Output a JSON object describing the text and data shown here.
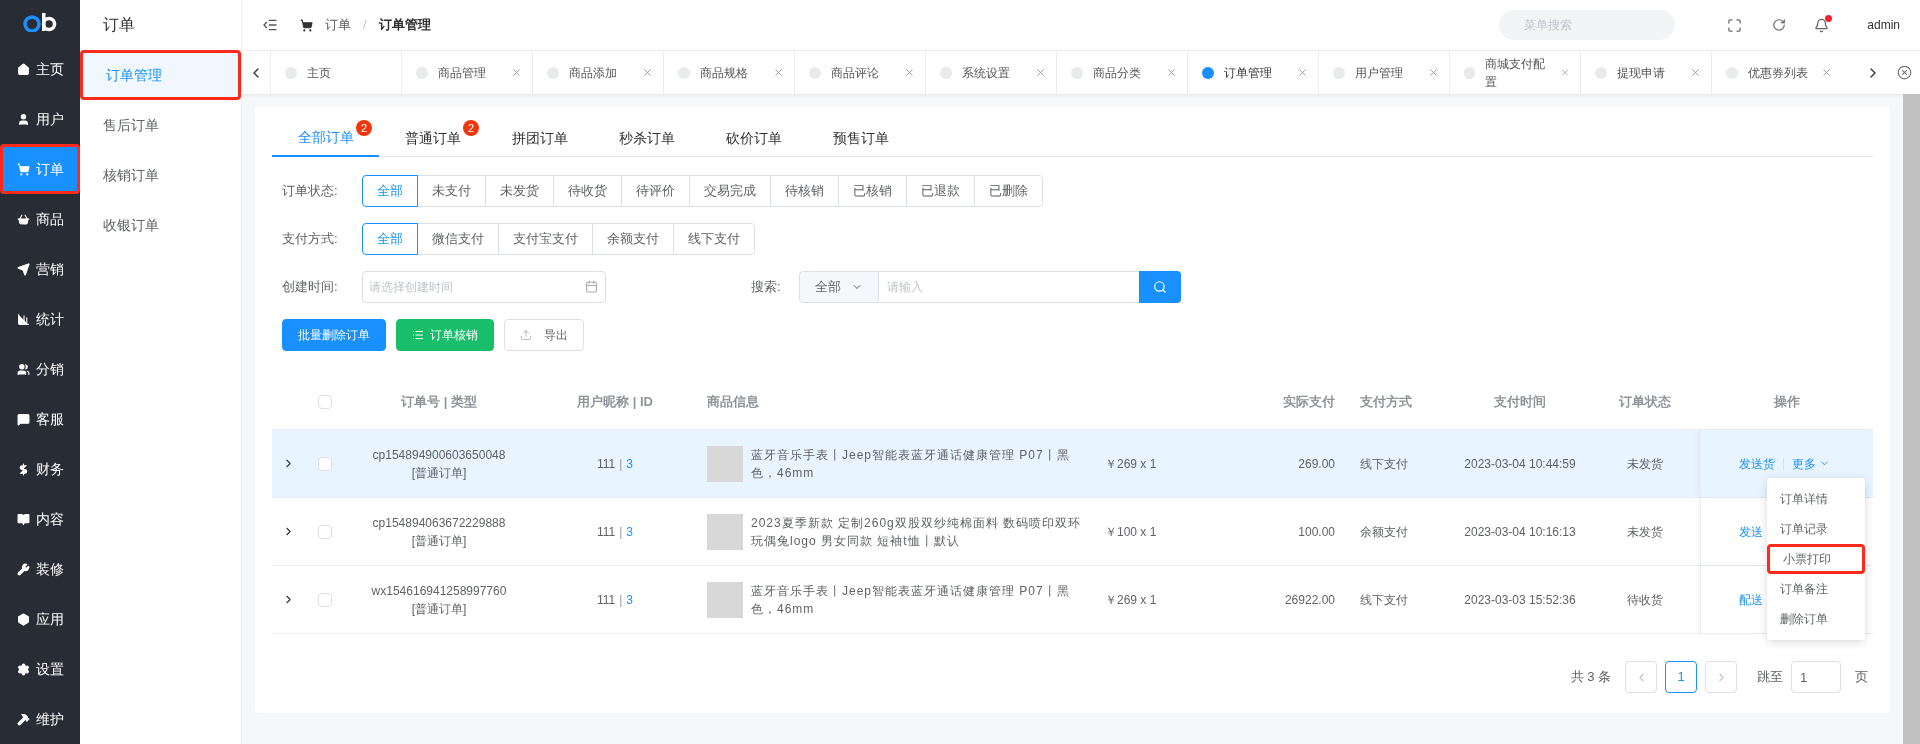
{
  "nav": {
    "items": [
      {
        "label": "主页",
        "selected": false,
        "annotated": false
      },
      {
        "label": "用户",
        "selected": false,
        "annotated": false
      },
      {
        "label": "订单",
        "selected": true,
        "annotated": true
      },
      {
        "label": "商品",
        "selected": false,
        "annotated": false
      },
      {
        "label": "营销",
        "selected": false,
        "annotated": false
      },
      {
        "label": "统计",
        "selected": false,
        "annotated": false
      },
      {
        "label": "分销",
        "selected": false,
        "annotated": false
      },
      {
        "label": "客服",
        "selected": false,
        "annotated": false
      },
      {
        "label": "财务",
        "selected": false,
        "annotated": false
      },
      {
        "label": "内容",
        "selected": false,
        "annotated": false
      },
      {
        "label": "装修",
        "selected": false,
        "annotated": false
      },
      {
        "label": "应用",
        "selected": false,
        "annotated": false
      },
      {
        "label": "设置",
        "selected": false,
        "annotated": false
      },
      {
        "label": "维护",
        "selected": false,
        "annotated": false
      }
    ]
  },
  "submenu": {
    "title": "订单",
    "items": [
      {
        "label": "订单管理",
        "selected": true,
        "annotated": true
      },
      {
        "label": "售后订单",
        "selected": false,
        "annotated": false
      },
      {
        "label": "核销订单",
        "selected": false,
        "annotated": false
      },
      {
        "label": "收银订单",
        "selected": false,
        "annotated": false
      }
    ]
  },
  "header": {
    "breadcrumb": [
      "订单",
      "订单管理"
    ],
    "breadcrumb_separator": "/",
    "search_placeholder": "菜单搜索",
    "user": "admin",
    "notification_dot": true
  },
  "page_tabs": [
    {
      "label": "主页",
      "selected": false,
      "closable": false
    },
    {
      "label": "商品管理",
      "selected": false,
      "closable": true
    },
    {
      "label": "商品添加",
      "selected": false,
      "closable": true
    },
    {
      "label": "商品规格",
      "selected": false,
      "closable": true
    },
    {
      "label": "商品评论",
      "selected": false,
      "closable": true
    },
    {
      "label": "系统设置",
      "selected": false,
      "closable": true
    },
    {
      "label": "商品分类",
      "selected": false,
      "closable": true
    },
    {
      "label": "订单管理",
      "selected": true,
      "closable": true
    },
    {
      "label": "用户管理",
      "selected": false,
      "closable": true
    },
    {
      "label": "商城支付配置",
      "selected": false,
      "closable": true
    },
    {
      "label": "提现申请",
      "selected": false,
      "closable": true
    },
    {
      "label": "优惠券列表",
      "selected": false,
      "closable": true
    }
  ],
  "order_tabs": [
    {
      "label": "全部订单",
      "selected": true,
      "badge": "2"
    },
    {
      "label": "普通订单",
      "selected": false,
      "badge": "2"
    },
    {
      "label": "拼团订单",
      "selected": false
    },
    {
      "label": "秒杀订单",
      "selected": false
    },
    {
      "label": "砍价订单",
      "selected": false
    },
    {
      "label": "预售订单",
      "selected": false
    }
  ],
  "status_filter": {
    "label": "订单状态:",
    "options": [
      {
        "label": "全部",
        "selected": true
      },
      {
        "label": "未支付",
        "selected": false
      },
      {
        "label": "未发货",
        "selected": false
      },
      {
        "label": "待收货",
        "selected": false
      },
      {
        "label": "待评价",
        "selected": false
      },
      {
        "label": "交易完成",
        "selected": false
      },
      {
        "label": "待核销",
        "selected": false
      },
      {
        "label": "已核销",
        "selected": false
      },
      {
        "label": "已退款",
        "selected": false
      },
      {
        "label": "已删除",
        "selected": false
      }
    ]
  },
  "pay_filter": {
    "label": "支付方式:",
    "options": [
      {
        "label": "全部",
        "selected": true
      },
      {
        "label": "微信支付",
        "selected": false
      },
      {
        "label": "支付宝支付",
        "selected": false
      },
      {
        "label": "余额支付",
        "selected": false
      },
      {
        "label": "线下支付",
        "selected": false
      }
    ]
  },
  "date_filter": {
    "label": "创建时间:",
    "placeholder": "请选择创建时间"
  },
  "search": {
    "label": "搜索:",
    "scope": "全部",
    "placeholder": "请输入"
  },
  "actions": [
    {
      "label": "批量删除订单",
      "kind": "primary"
    },
    {
      "label": "订单核销",
      "kind": "success"
    },
    {
      "label": "导出",
      "kind": "default"
    }
  ],
  "table": {
    "select_all_checked": false,
    "columns": [
      "订单号 | 类型",
      "用户昵称 | ID",
      "商品信息",
      "实际支付",
      "支付方式",
      "支付时间",
      "订单状态",
      "操作"
    ],
    "rows": [
      {
        "checked": false,
        "user_separator": "|",
        "order_no": "cp154894900603650048",
        "order_type": "[普通订单]",
        "user_name": "111",
        "user_id": "3",
        "product": "蓝牙音乐手表丨Jeep智能表蓝牙通话健康管理 P07丨黑色，46mm",
        "price": "￥269 x 1",
        "paid": "269.00",
        "pay_method": "线下支付",
        "pay_time": "2023-03-04 10:44:59",
        "status": "未发货",
        "highlighted": true,
        "actions": [
          "发送货",
          "更多"
        ]
      },
      {
        "checked": false,
        "user_separator": "|",
        "order_no": "cp154894063672229888",
        "order_type": "[普通订单]",
        "user_name": "111",
        "user_id": "3",
        "product": "2023夏季新款 定制260g双股双纱纯棉面料 数码喷印双环玩偶兔logo 男女同款 短袖t恤丨默认",
        "price": "￥100 x 1",
        "paid": "100.00",
        "pay_method": "余额支付",
        "pay_time": "2023-03-04 10:16:13",
        "status": "未发货",
        "highlighted": false,
        "actions": [
          "发送"
        ]
      },
      {
        "checked": false,
        "user_separator": "|",
        "order_no": "wx154616941258997760",
        "order_type": "[普通订单]",
        "user_name": "111",
        "user_id": "3",
        "product": "蓝牙音乐手表丨Jeep智能表蓝牙通话健康管理 P07丨黑色，46mm",
        "price": "￥269 x 1",
        "paid": "26922.00",
        "pay_method": "线下支付",
        "pay_time": "2023-03-03 15:52:36",
        "status": "待收货",
        "highlighted": false,
        "actions": [
          "配送"
        ]
      }
    ]
  },
  "more_menu": [
    {
      "label": "订单详情",
      "annotated": false
    },
    {
      "label": "订单记录",
      "annotated": false
    },
    {
      "label": "小票打印",
      "annotated": true
    },
    {
      "label": "订单备注",
      "annotated": false
    },
    {
      "label": "删除订单",
      "annotated": false
    }
  ],
  "pagination": {
    "total": "共 3 条",
    "pages": [
      {
        "label": "1",
        "selected": true
      }
    ],
    "jump_label": "跳至",
    "jump_value": "1",
    "suffix": "页"
  }
}
